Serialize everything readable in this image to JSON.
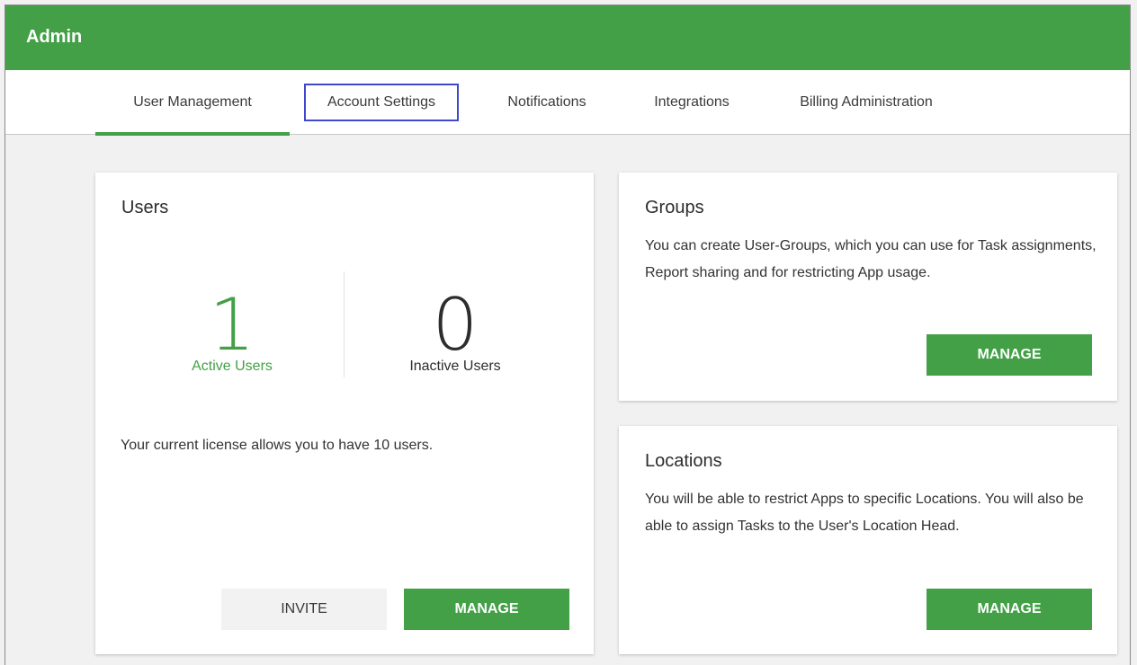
{
  "app": {
    "title": "Admin"
  },
  "tabs": [
    {
      "label": "User Management",
      "active": true
    },
    {
      "label": "Account Settings",
      "highlighted": true
    },
    {
      "label": "Notifications"
    },
    {
      "label": "Integrations"
    },
    {
      "label": "Billing Administration"
    }
  ],
  "users_card": {
    "title": "Users",
    "active_count": "1",
    "active_label": "Active Users",
    "inactive_count": "0",
    "inactive_label": "Inactive Users",
    "license_text": "Your current license allows you to have 10 users.",
    "invite_label": "INVITE",
    "manage_label": "MANAGE"
  },
  "groups_card": {
    "title": "Groups",
    "description": "You can create User-Groups, which you can use for Task assignments, Report sharing and for restricting App usage.",
    "manage_label": "MANAGE"
  },
  "locations_card": {
    "title": "Locations",
    "description": "You will be able to restrict Apps to specific Locations. You will also be able to assign Tasks to the User's Location Head.",
    "manage_label": "MANAGE"
  },
  "colors": {
    "accent": "#43a047",
    "highlight_border": "#3f48cc"
  }
}
